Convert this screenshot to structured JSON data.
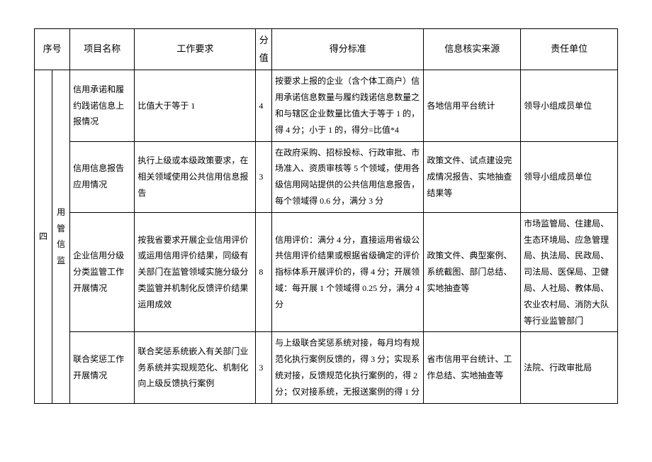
{
  "header": {
    "seq": "序号",
    "name": "项目名称",
    "req": "工作要求",
    "score": "分值",
    "std": "得分标准",
    "src": "信息核实来源",
    "dept": "责任单位"
  },
  "section": {
    "seq": "四",
    "category": "用管信监"
  },
  "rows": [
    {
      "name": "信用承诺和履约践诺信息上报情况",
      "req": "比值大于等于 1",
      "score": "4",
      "std": "按要求上报的企业（含个体工商户）信用承诺信息数量与履约践诺信息数量之和与辖区企业数量比值大于等于 1 的，得 4 分；小于 1 的，得分=比值*4",
      "src": "各地信用平台统计",
      "dept": "领导小组成员单位"
    },
    {
      "name": "信用信息报告应用情况",
      "req": "执行上级或本级政策要求，在相关领域使用公共信用信息报告",
      "score": "3",
      "std": "在政府采购、招标投标、行政审批、市场准入、资质审核等 5 个领域，使用各级信用网站提供的公共信用信息报告，每个领域得 0.6 分，满分 3 分",
      "src": "政策文件、试点建设完成情况报告、实地抽查结果等",
      "dept": "领导小组成员单位"
    },
    {
      "name": "企业信用分级分类监管工作开展情况",
      "req": "按我省要求开展企业信用评价或运用信用评价结果，同级有关部门在监管领域实施分级分类监管并机制化反馈评价结果运用成效",
      "score": "8",
      "std": "信用评价：满分 4 分，直接运用省级公共信用评价结果或根据省级确定的评价指标体系开展评价的，得 4 分；开展领域：每开展 1 个领域得 0.25 分，满分 4 分",
      "src": "政策文件、典型案例、系统截图、部门总结、实地抽查等",
      "dept": "市场监管局、住建局、生态环境局、应急管理局、执法局、民政局、司法局、医保局、卫健局、人社局、教体局、农业农村局、消防大队等行业监管部门"
    },
    {
      "name": "联合奖惩工作开展情况",
      "req": "联合奖惩系统嵌入有关部门业务系统并实现规范化、机制化向上级反馈执行案例",
      "score": "3",
      "std": "与上级联合奖惩系统对接，每月均有规范化执行案例反馈的，得 3 分；实现系统对接，反馈规范化执行案例的，得 2 分；仅对接系统，无报送案例的得 1 分",
      "src": "省市信用平台统计、工作总结、实地抽查等",
      "dept": "法院、行政审批局"
    }
  ]
}
